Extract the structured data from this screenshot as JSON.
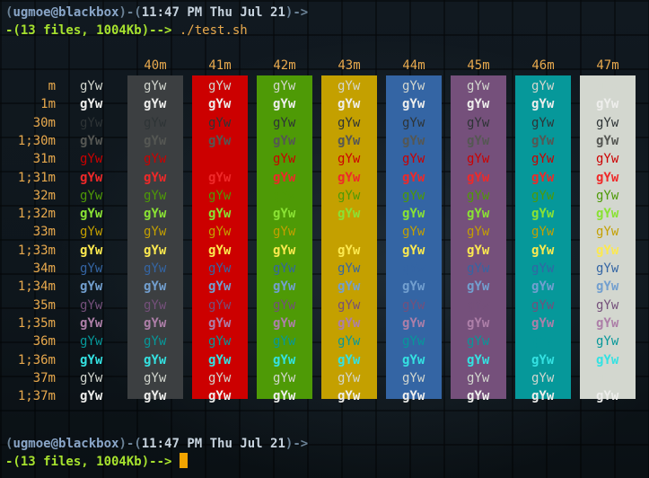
{
  "prompt_top": {
    "open_paren": "(",
    "userhost": "ugmoe@blackbox",
    "sep": ")-(",
    "time": "11:47 PM Thu Jul 21",
    "end": ")->"
  },
  "info_top": {
    "open": "-(",
    "text": "13 files, 1004Kb",
    "arrow": ")--> ",
    "command": "./test.sh"
  },
  "prompt_bottom": {
    "open_paren": "(",
    "userhost": "ugmoe@blackbox",
    "sep": ")-(",
    "time": "11:47 PM Thu Jul 21",
    "end": ")->"
  },
  "info_bottom": {
    "open": "-(",
    "text": "13 files, 1004Kb",
    "arrow": ")--> "
  },
  "sample_text": "gYw",
  "bg_columns": [
    {
      "label": "40m",
      "color": "#3c3f41"
    },
    {
      "label": "41m",
      "color": "#cc0000"
    },
    {
      "label": "42m",
      "color": "#4e9a06"
    },
    {
      "label": "43m",
      "color": "#c4a000"
    },
    {
      "label": "44m",
      "color": "#3465a4"
    },
    {
      "label": "45m",
      "color": "#75507b"
    },
    {
      "label": "46m",
      "color": "#06989a"
    },
    {
      "label": "47m",
      "color": "#d3d7cf"
    }
  ],
  "fg_rows": [
    {
      "label": "m",
      "color": "#d3d7cf",
      "bold": false
    },
    {
      "label": "1m",
      "color": "#eeeeec",
      "bold": true
    },
    {
      "label": "30m",
      "color": "#2e3436",
      "bold": false
    },
    {
      "label": "1;30m",
      "color": "#555753",
      "bold": true
    },
    {
      "label": "31m",
      "color": "#cc0000",
      "bold": false
    },
    {
      "label": "1;31m",
      "color": "#ef2929",
      "bold": true
    },
    {
      "label": "32m",
      "color": "#4e9a06",
      "bold": false
    },
    {
      "label": "1;32m",
      "color": "#8ae234",
      "bold": true
    },
    {
      "label": "33m",
      "color": "#c4a000",
      "bold": false
    },
    {
      "label": "1;33m",
      "color": "#fce94f",
      "bold": true
    },
    {
      "label": "34m",
      "color": "#3465a4",
      "bold": false
    },
    {
      "label": "1;34m",
      "color": "#729fcf",
      "bold": true
    },
    {
      "label": "35m",
      "color": "#75507b",
      "bold": false
    },
    {
      "label": "1;35m",
      "color": "#ad7fa8",
      "bold": true
    },
    {
      "label": "36m",
      "color": "#06989a",
      "bold": false
    },
    {
      "label": "1;36m",
      "color": "#34e2e2",
      "bold": true
    },
    {
      "label": "37m",
      "color": "#d3d7cf",
      "bold": false
    },
    {
      "label": "1;37m",
      "color": "#eeeeec",
      "bold": true
    }
  ],
  "colors": {
    "prompt_dim": "#6b8296",
    "prompt_user": "#8aa6c8",
    "prompt_time": "#c7d3de",
    "info_green": "#a7e22e",
    "orange": "#e8a94d",
    "cursor": "#f2a400"
  }
}
